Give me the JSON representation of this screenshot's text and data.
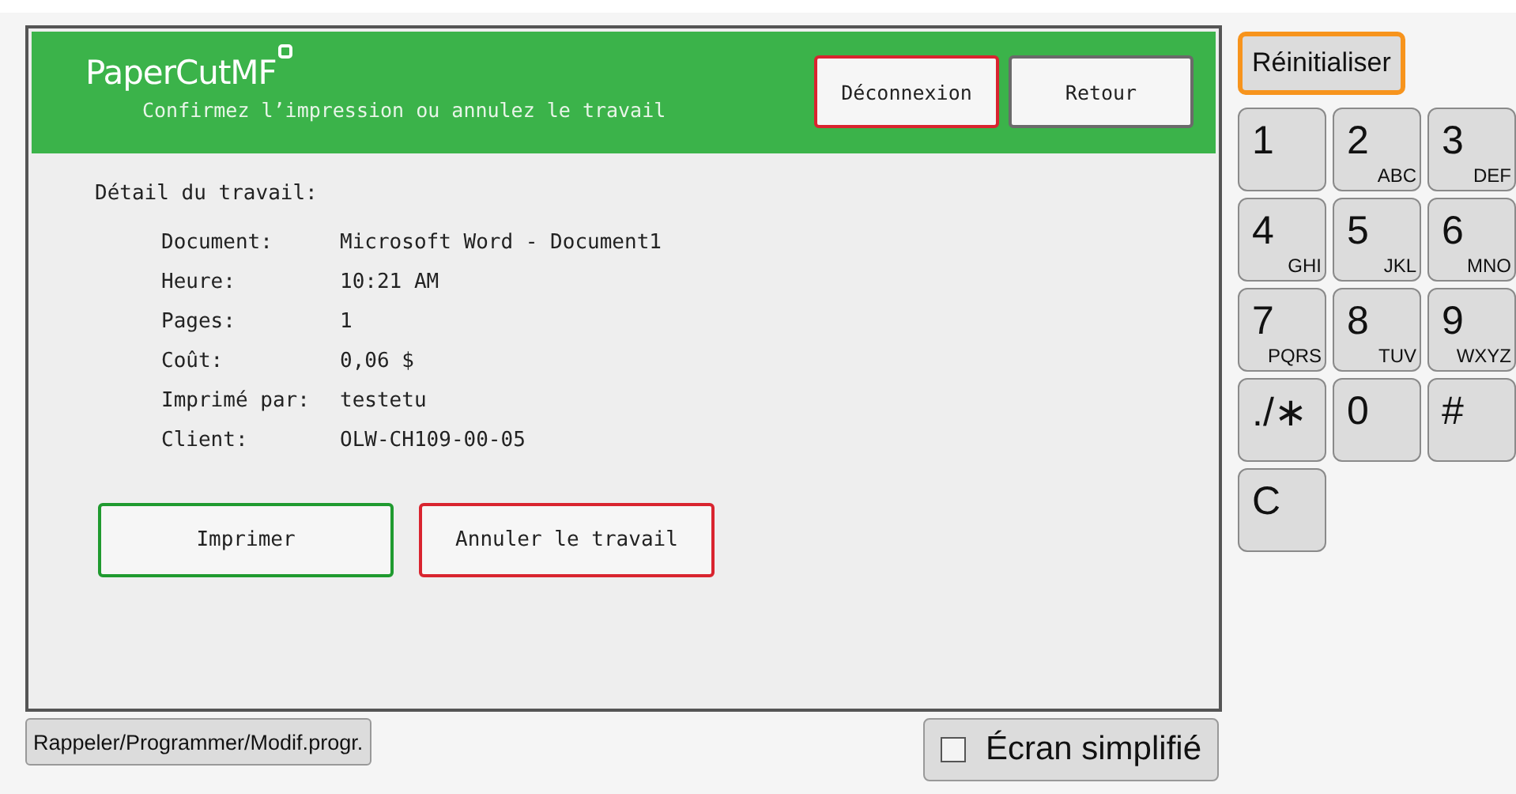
{
  "header": {
    "logo": "PaperCutMF",
    "subtitle": "Confirmez l’impression ou annulez le travail",
    "buttons": [
      {
        "label": "Déconnexion",
        "kind": "danger"
      },
      {
        "label": "Retour",
        "kind": "plain"
      }
    ]
  },
  "details": {
    "title": "Détail du travail:",
    "rows": [
      {
        "label": "Document:",
        "value": "Microsoft Word - Document1"
      },
      {
        "label": "Heure:",
        "value": "10:21 AM"
      },
      {
        "label": "Pages:",
        "value": "1"
      },
      {
        "label": "Coût:",
        "value": "0,06 $"
      },
      {
        "label": "Imprimé par:",
        "value": "testetu"
      },
      {
        "label": "Client:",
        "value": "OLW-CH109-00-05"
      }
    ]
  },
  "actions": [
    {
      "label": "Imprimer",
      "kind": "confirm"
    },
    {
      "label": "Annuler le travail",
      "kind": "danger"
    }
  ],
  "reset_button": "Réinitialiser",
  "keypad": [
    {
      "key": "1"
    },
    {
      "key": "2",
      "letters": "ABC"
    },
    {
      "key": "3",
      "letters": "DEF"
    },
    {
      "key": "4",
      "letters": "GHI"
    },
    {
      "key": "5",
      "letters": "JKL"
    },
    {
      "key": "6",
      "letters": "MNO"
    },
    {
      "key": "7",
      "letters": "PQRS"
    },
    {
      "key": "8",
      "letters": "TUV"
    },
    {
      "key": "9",
      "letters": "WXYZ"
    },
    {
      "key": "./∗"
    },
    {
      "key": "0"
    },
    {
      "key": "#"
    },
    {
      "key": "C"
    }
  ],
  "bottom": {
    "recall_button": "Rappeler/Programmer/Modif.progr.",
    "simple_screen": {
      "label": "Écran simplifié",
      "checked": false
    }
  }
}
